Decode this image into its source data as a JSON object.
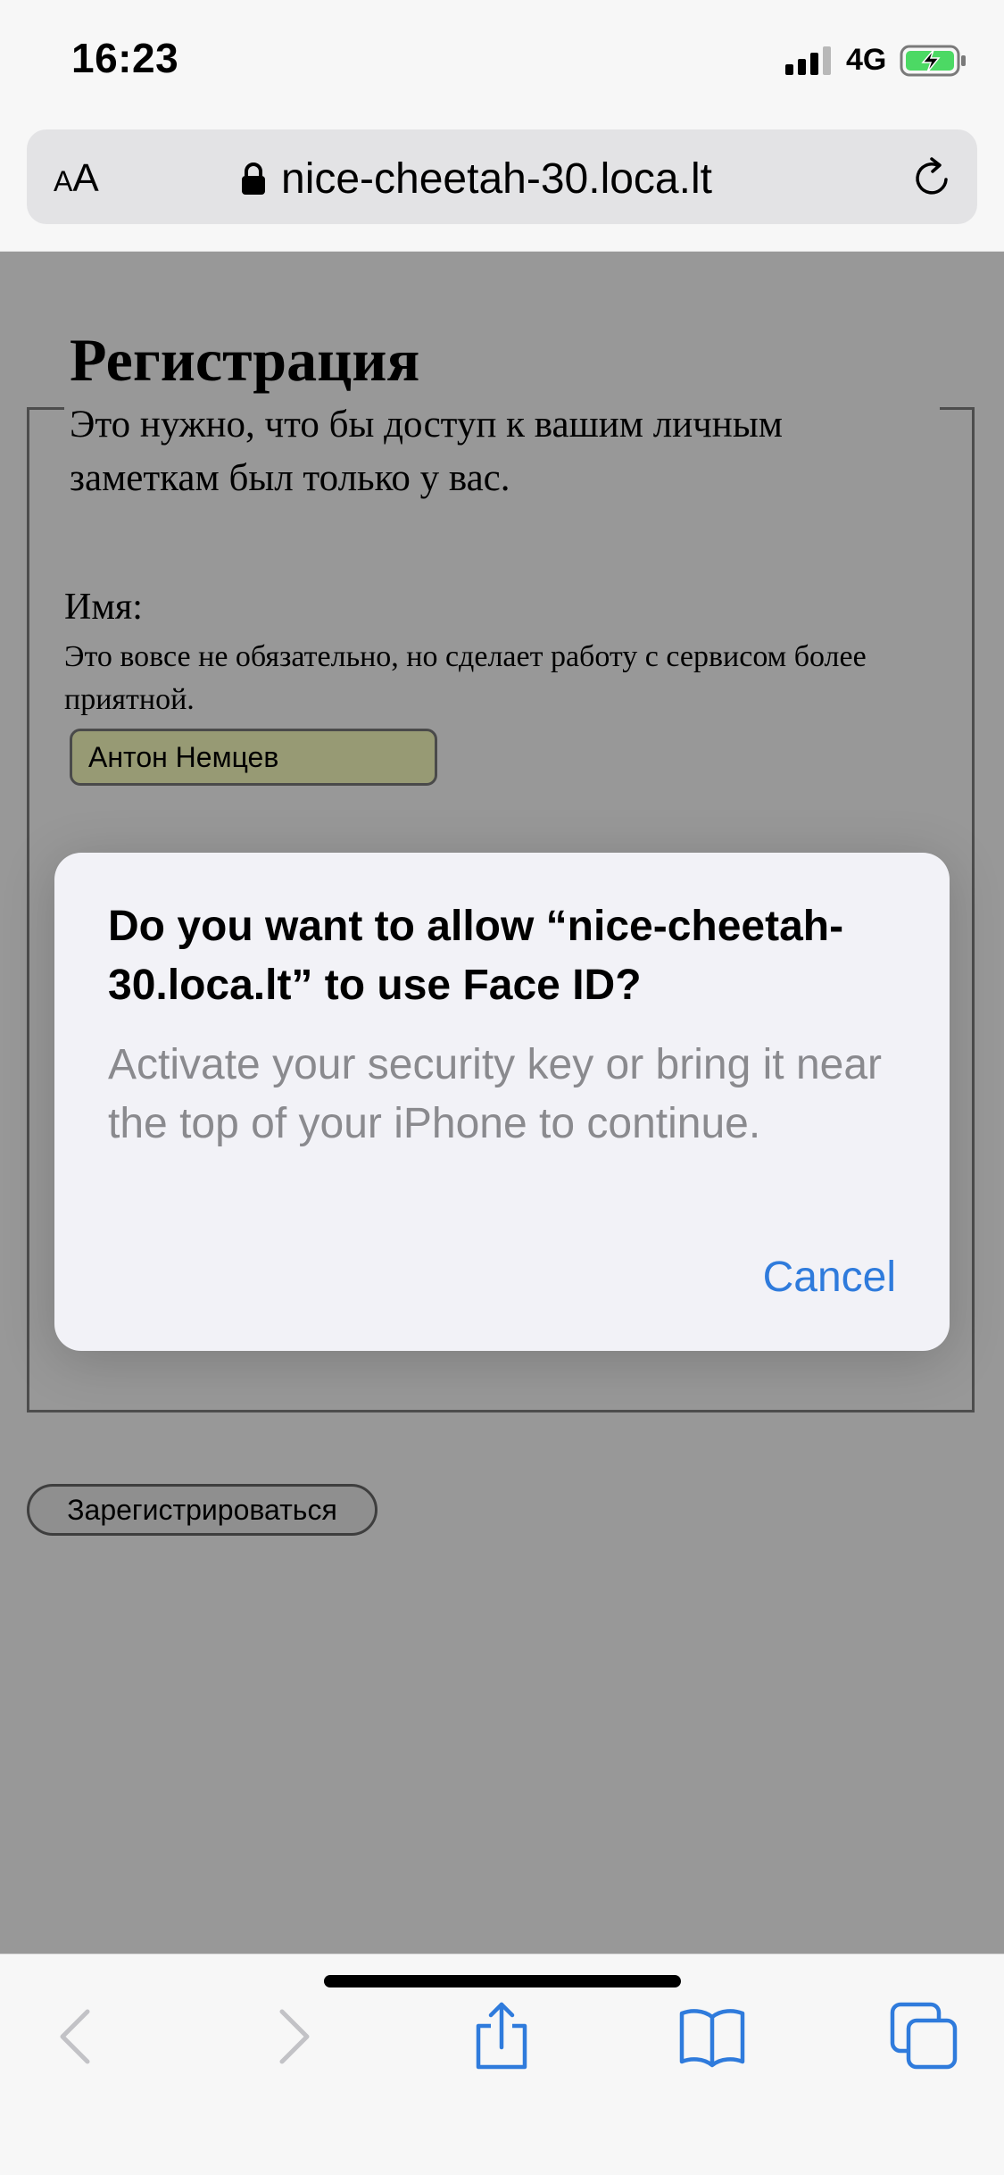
{
  "status_bar": {
    "time": "16:23",
    "network": "4G",
    "signal_bars": 3,
    "battery_charging": true
  },
  "address_bar": {
    "aa_small": "A",
    "aa_large": "A",
    "url": "nice-cheetah-30.loca.lt",
    "icons": [
      "lock-icon",
      "reload-icon"
    ]
  },
  "page": {
    "title": "Регистрация",
    "legend": "Это нужно, что бы доступ к вашим личным заметкам был только у вас.",
    "name_label": "Имя:",
    "name_hint": "Это вовсе не обязательно, но сделает работу с сервисом более приятной.",
    "name_value": "Антон Немцев",
    "register_label": "Зарегистрироваться"
  },
  "dialog": {
    "title": "Do you want to allow “nice-cheetah-30.loca.lt” to use Face ID?",
    "message": "Activate your security key or bring it near the top of your iPhone to continue.",
    "cancel_label": "Cancel"
  },
  "toolbar": {
    "icons": [
      "back-icon",
      "forward-icon",
      "share-icon",
      "bookmarks-icon",
      "tabs-icon"
    ]
  },
  "colors": {
    "accent": "#2f7bdc",
    "dim_overlay": "#989898",
    "input_bg": "#979a74",
    "dialog_bg": "#f2f2f7",
    "message_gray": "#8a8a8e"
  }
}
